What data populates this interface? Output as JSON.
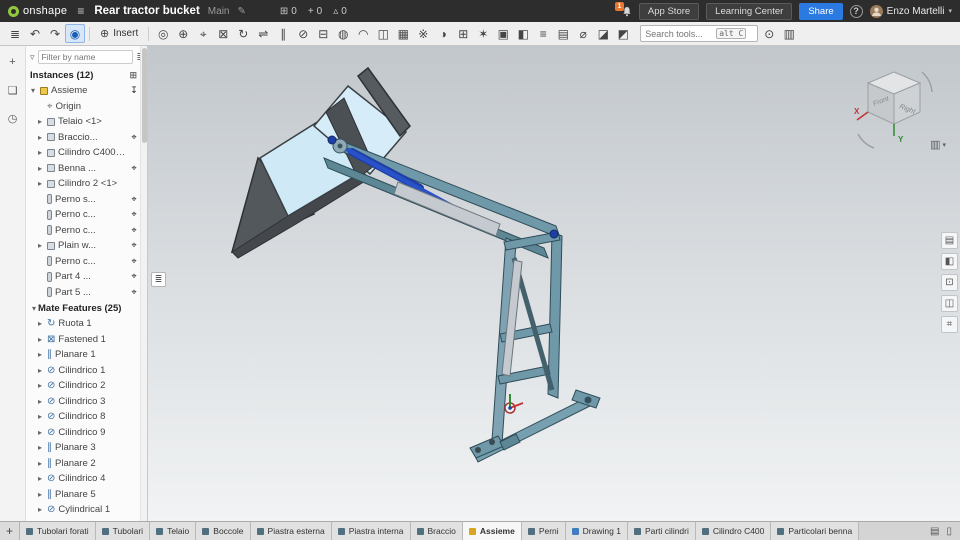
{
  "topbar": {
    "brand": "onshape",
    "title": "Rear tractor bucket",
    "branch": "Main",
    "stats": [
      {
        "name": "versions-stat",
        "glyph": "⊞",
        "value": "0"
      },
      {
        "name": "changes-stat",
        "glyph": "+",
        "value": "0"
      },
      {
        "name": "issues-stat",
        "glyph": "▵",
        "value": "0"
      }
    ],
    "notification_count": "1",
    "app_store": "App Store",
    "learning_center": "Learning Center",
    "share": "Share",
    "help": "?",
    "user_name": "Enzo Martelli"
  },
  "toolbar": {
    "insert_label": "Insert",
    "search_placeholder": "Search tools...",
    "search_shortcut": "alt C",
    "icons_left": [
      {
        "name": "structure-tree-icon",
        "glyph": "≣",
        "state": ""
      },
      {
        "name": "undo-icon",
        "glyph": "↶",
        "state": ""
      },
      {
        "name": "redo-icon",
        "glyph": "↷",
        "state": ""
      },
      {
        "name": "select-tool-icon",
        "glyph": "◉",
        "state": "active"
      }
    ],
    "icons_main": [
      {
        "name": "sketch-icon",
        "glyph": "◎",
        "state": ""
      },
      {
        "name": "mate-icon",
        "glyph": "⊕",
        "state": ""
      },
      {
        "name": "mate-connector-icon",
        "glyph": "⌖",
        "state": ""
      },
      {
        "name": "fastened-mate-icon",
        "glyph": "⊠",
        "state": ""
      },
      {
        "name": "revolute-mate-icon",
        "glyph": "↻",
        "state": ""
      },
      {
        "name": "slider-mate-icon",
        "glyph": "⇌",
        "state": ""
      },
      {
        "name": "planar-mate-icon",
        "glyph": "∥",
        "state": ""
      },
      {
        "name": "cylindrical-mate-icon",
        "glyph": "⊘",
        "state": ""
      },
      {
        "name": "pin-slot-mate-icon",
        "glyph": "⊟",
        "state": ""
      },
      {
        "name": "ball-mate-icon",
        "glyph": "◍",
        "state": ""
      },
      {
        "name": "tangent-mate-icon",
        "glyph": "◠",
        "state": ""
      },
      {
        "name": "group-icon",
        "glyph": "◫",
        "state": ""
      },
      {
        "name": "linear-pattern-icon",
        "glyph": "▦",
        "state": ""
      },
      {
        "name": "circular-pattern-icon",
        "glyph": "※",
        "state": ""
      },
      {
        "name": "mirror-icon",
        "glyph": "◑",
        "state": ""
      },
      {
        "name": "replicate-icon",
        "glyph": "⊞",
        "state": ""
      },
      {
        "name": "explode-icon",
        "glyph": "✶",
        "state": ""
      },
      {
        "name": "snapshot-icon",
        "glyph": "▣",
        "state": ""
      },
      {
        "name": "display-states-icon",
        "glyph": "◧",
        "state": ""
      },
      {
        "name": "named-positions-icon",
        "glyph": "≡",
        "state": ""
      },
      {
        "name": "bom-icon",
        "glyph": "▤",
        "state": ""
      },
      {
        "name": "measure-icon",
        "glyph": "⌀",
        "state": ""
      },
      {
        "name": "section-view-icon",
        "glyph": "◪",
        "state": ""
      },
      {
        "name": "appearance-icon",
        "glyph": "◩",
        "state": ""
      }
    ],
    "icons_right": [
      {
        "name": "analysis-icon",
        "glyph": "⊙",
        "state": ""
      },
      {
        "name": "panel-toggle-icon",
        "glyph": "▥",
        "state": ""
      }
    ]
  },
  "leftrail": [
    {
      "name": "add-studio-icon",
      "glyph": "+"
    },
    {
      "name": "comment-icon",
      "glyph": "❏"
    },
    {
      "name": "history-icon",
      "glyph": "◷"
    }
  ],
  "left_panel": {
    "filter_placeholder": "Filter by name",
    "instances_header": "Instances (12)",
    "header_action_glyph": "⊞",
    "instances": [
      {
        "label": "Assieme",
        "icon": "ico-assembly",
        "arrow": "expanded",
        "trail": "anchor-icon",
        "lvl": "lvl0"
      },
      {
        "label": "Origin",
        "icon": "ico-origin",
        "arrow": "",
        "trail": "",
        "lvl": "lvl1"
      },
      {
        "label": "Telaio <1>",
        "icon": "ico-part",
        "arrow": "collapsed",
        "trail": "",
        "lvl": "lvl1"
      },
      {
        "label": "Braccio...",
        "icon": "ico-part",
        "arrow": "collapsed",
        "trail": "mateconnector-icon",
        "lvl": "lvl1"
      },
      {
        "label": "Cilindro C400 <1>",
        "icon": "ico-part",
        "arrow": "collapsed",
        "trail": "",
        "lvl": "lvl1"
      },
      {
        "label": "Benna ...",
        "icon": "ico-part",
        "arrow": "collapsed",
        "trail": "mateconnector-icon",
        "lvl": "lvl1"
      },
      {
        "label": "Cilindro 2 <1>",
        "icon": "ico-part",
        "arrow": "collapsed",
        "trail": "",
        "lvl": "lvl1"
      },
      {
        "label": "Perno s...",
        "icon": "ico-pin",
        "arrow": "",
        "trail": "mateconnector-icon",
        "lvl": "lvl1"
      },
      {
        "label": "Perno c...",
        "icon": "ico-pin",
        "arrow": "",
        "trail": "mateconnector-icon",
        "lvl": "lvl1"
      },
      {
        "label": "Perno c...",
        "icon": "ico-pin",
        "arrow": "",
        "trail": "mateconnector-icon",
        "lvl": "lvl1"
      },
      {
        "label": "Plain w...",
        "icon": "ico-part",
        "arrow": "collapsed",
        "trail": "mateconnector-icon",
        "lvl": "lvl1"
      },
      {
        "label": "Perno c...",
        "icon": "ico-pin",
        "arrow": "",
        "trail": "mateconnector-icon",
        "lvl": "lvl1"
      },
      {
        "label": "Part 4 ...",
        "icon": "ico-pin",
        "arrow": "",
        "trail": "mateconnector-icon",
        "lvl": "lvl1"
      },
      {
        "label": "Part 5 ...",
        "icon": "ico-pin",
        "arrow": "",
        "trail": "mateconnector-icon",
        "lvl": "lvl1"
      }
    ],
    "mates_header": "Mate Features (25)",
    "mates": [
      {
        "label": "Ruota 1",
        "icon": "ico-mate-revolute",
        "arrow": "collapsed",
        "trail": "",
        "lvl": "lvl1"
      },
      {
        "label": "Fastened 1",
        "icon": "ico-mate-fastened",
        "arrow": "collapsed",
        "trail": "",
        "lvl": "lvl1"
      },
      {
        "label": "Planare 1",
        "icon": "ico-mate-planar",
        "arrow": "collapsed",
        "trail": "",
        "lvl": "lvl1"
      },
      {
        "label": "Cilindrico 1",
        "icon": "ico-mate-cylindrical",
        "arrow": "collapsed",
        "trail": "",
        "lvl": "lvl1"
      },
      {
        "label": "Cilindrico 2",
        "icon": "ico-mate-cylindrical",
        "arrow": "collapsed",
        "trail": "",
        "lvl": "lvl1"
      },
      {
        "label": "Cilindrico 3",
        "icon": "ico-mate-cylindrical",
        "arrow": "collapsed",
        "trail": "",
        "lvl": "lvl1"
      },
      {
        "label": "Cilindrico 8",
        "icon": "ico-mate-cylindrical",
        "arrow": "collapsed",
        "trail": "",
        "lvl": "lvl1"
      },
      {
        "label": "Cilindrico 9",
        "icon": "ico-mate-cylindrical",
        "arrow": "collapsed",
        "trail": "",
        "lvl": "lvl1"
      },
      {
        "label": "Planare 3",
        "icon": "ico-mate-planar",
        "arrow": "collapsed",
        "trail": "",
        "lvl": "lvl1"
      },
      {
        "label": "Planare 2",
        "icon": "ico-mate-planar",
        "arrow": "collapsed",
        "trail": "",
        "lvl": "lvl1"
      },
      {
        "label": "Cilindrico 4",
        "icon": "ico-mate-cylindrical",
        "arrow": "collapsed",
        "trail": "",
        "lvl": "lvl1"
      },
      {
        "label": "Planare 5",
        "icon": "ico-mate-planar",
        "arrow": "collapsed",
        "trail": "",
        "lvl": "lvl1"
      },
      {
        "label": "Cylindrical 1",
        "icon": "ico-mate-cylindrical",
        "arrow": "collapsed",
        "trail": "",
        "lvl": "lvl1"
      }
    ]
  },
  "viewport": {
    "viewcube": {
      "right_label": "Right",
      "front_label": "Front",
      "x_label": "X",
      "y_label": "Y"
    },
    "rightrail": [
      {
        "name": "model-configurations-icon",
        "glyph": "▤"
      },
      {
        "name": "appearance-panel-icon",
        "glyph": "◧"
      },
      {
        "name": "mates-panel-icon",
        "glyph": "⊡"
      },
      {
        "name": "versions-panel-icon",
        "glyph": "◫"
      },
      {
        "name": "selection-panel-icon",
        "glyph": "⌗"
      }
    ]
  },
  "tabbar": {
    "tabs": [
      {
        "label": "Tubolari forati",
        "icon": "part-icon",
        "state": ""
      },
      {
        "label": "Tubolari",
        "icon": "part-icon",
        "state": ""
      },
      {
        "label": "Telaio",
        "icon": "part-icon",
        "state": ""
      },
      {
        "label": "Boccole",
        "icon": "part-icon",
        "state": ""
      },
      {
        "label": "Piastra esterna",
        "icon": "part-icon",
        "state": ""
      },
      {
        "label": "Piastra interna",
        "icon": "part-icon",
        "state": ""
      },
      {
        "label": "Braccio",
        "icon": "part-icon",
        "state": ""
      },
      {
        "label": "Assieme",
        "icon": "assembly-icon",
        "state": "active"
      },
      {
        "label": "Perni",
        "icon": "part-icon",
        "state": ""
      },
      {
        "label": "Drawing 1",
        "icon": "drawing-icon",
        "state": ""
      },
      {
        "label": "Parti cilindri",
        "icon": "part-icon",
        "state": ""
      },
      {
        "label": "Cilindro C400",
        "icon": "part-icon",
        "state": ""
      },
      {
        "label": "Particolari benna",
        "icon": "part-icon",
        "state": ""
      }
    ],
    "right_icons": [
      {
        "name": "print-icon",
        "glyph": "▤"
      },
      {
        "name": "devices-icon",
        "glyph": "▯"
      }
    ]
  }
}
